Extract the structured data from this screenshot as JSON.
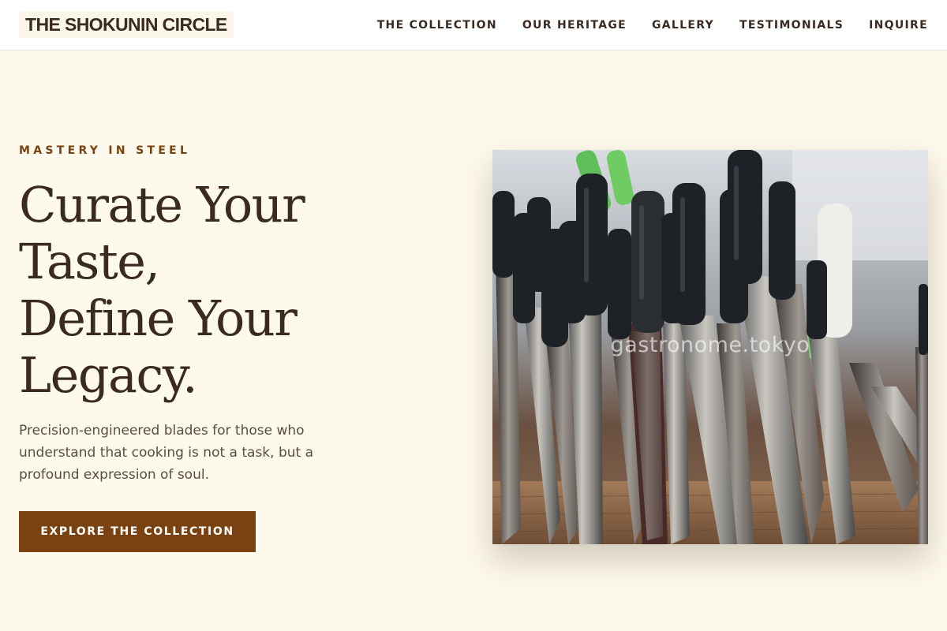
{
  "brand": {
    "name": "THE SHOKUNIN CIRCLE"
  },
  "nav": {
    "items": [
      {
        "label": "THE COLLECTION"
      },
      {
        "label": "OUR HERITAGE"
      },
      {
        "label": "GALLERY"
      },
      {
        "label": "TESTIMONIALS"
      },
      {
        "label": "INQUIRE"
      }
    ]
  },
  "hero": {
    "eyebrow": "MASTERY IN STEEL",
    "headline_lines": [
      "Curate Your",
      "Taste,",
      "Define Your",
      "Legacy."
    ],
    "description": "Precision-engineered blades for those who understand that cooking is not a task, but a profound expression of soul.",
    "cta_label": "EXPLORE THE COLLECTION",
    "image": {
      "subject": "row of kitchen knives standing upright",
      "watermark": "gastronome.tokyo"
    }
  },
  "colors": {
    "accent": "#7a4210",
    "background": "#fdf9ec",
    "text": "#3a2a22"
  }
}
